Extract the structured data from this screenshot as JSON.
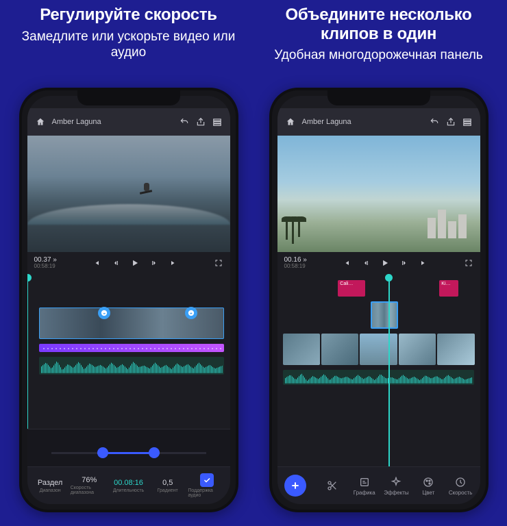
{
  "left": {
    "title": "Регулируйте скорость",
    "subtitle": "Замедлите или ускорьте видео или аудио",
    "project": "Amber Laguna",
    "timecode": "00.37 »",
    "subtimecode": "00:58:19",
    "playhead_pos": "48%",
    "bottom": {
      "section": "Раздел",
      "section_sub": "Диапазон",
      "speed_val": "76%",
      "speed_sub": "Скорость диапазона",
      "dur_val": "00.08:16",
      "dur_sub": "Длительность",
      "grad_val": "0,5",
      "grad_sub": "Градиент",
      "check_sub": "Поддержка аудио"
    }
  },
  "right": {
    "title": "Объедините несколько клипов в один",
    "subtitle": "Удобная многодорожечная панель",
    "project": "Amber Laguna",
    "timecode": "00.16 »",
    "subtimecode": "00:58:19",
    "playhead_pos": "55%",
    "clips": {
      "a": "Cali…",
      "b": "Ki…"
    },
    "tools": {
      "graphics": "Графика",
      "effects": "Эффекты",
      "color": "Цвет",
      "speed": "Скорость"
    }
  }
}
